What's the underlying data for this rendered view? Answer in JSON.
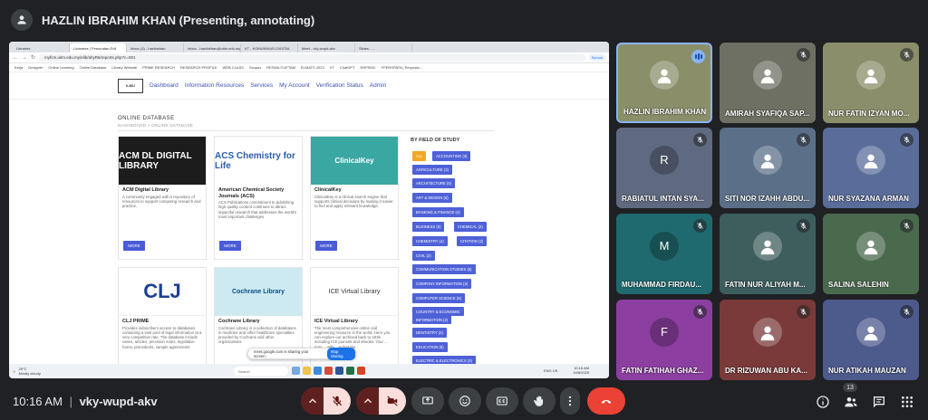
{
  "presenter_banner": "HAZLIN IBRAHIM KHAN (Presenting, annotating)",
  "browser": {
    "tabs": [
      "Libraries",
      "Ucimates | Persuratan-Full",
      "Inbox (3) - hazlinkhan",
      "Inbox - hazlinkhan@uitm.edu.my",
      "KT - KOMUNIKASI DIGITAL",
      "Meet - vky-wupd-akv",
      "Slides - ..."
    ],
    "url": "myfcm.uitm.edu.my/elib/ahyR6/reports.php?c=001",
    "profile": "School",
    "bookmarks": [
      "Kerja",
      "Designer",
      "Online Learning",
      "Online Database",
      "Library Website",
      "PRIME RESEARCH",
      "RESEARCH PROFILE",
      "WEB CLASS",
      "Scopus",
      "RESMA CUPTAM",
      "ELMATS 2023",
      "VT",
      "ChatGPT",
      "ERPSMC",
      "FPERSPATA | Perpusta..."
    ]
  },
  "site": {
    "logo": "ILMU",
    "nav": [
      "Dashboard",
      "Information Resources",
      "Services",
      "My Account",
      "Verification Status",
      "Admin"
    ],
    "section_title": "ONLINE DATABASE",
    "breadcrumb": "DASHBOARD > ONLINE DATABASE",
    "more_label": "MORE",
    "cards": [
      {
        "title": "ACM Digital Library",
        "desc": "A community engaged with a repository of resources to support computing research and practice.",
        "image": "ACM DL DIGITAL LIBRARY"
      },
      {
        "title": "American Chemical Society Journals (ACS)",
        "desc": "ACS Publications commitment to publishing high quality content continues to attract impactful research that addresses the world's most important challenges",
        "image": "ACS Chemistry for Life"
      },
      {
        "title": "ClinicalKey",
        "desc": "ClinicalKey is a clinical search engine that supports clinical decisions by making it easier to find and apply relevant knowledge.",
        "image": "ClinicalKey"
      },
      {
        "title": "CLJ PRIME",
        "desc": "Provides subscribers access to databases containing a vast pool of legal information at a very competitive rate. The database include cases, articles, precision notes, legislative forms, precedents, sample agreements",
        "image": "CLJ"
      },
      {
        "title": "Cochrane Library",
        "desc": "Cochrane Library is a collection of databases in medicine and other healthcare specialties provided by Cochrane and other organizations",
        "image": "Cochrane Library"
      },
      {
        "title": "ICE Virtual Library",
        "desc": "The most comprehensive online civil engineering resource in the world. Here you can explore our archived back to 1836 including ICE journals and ebooks. Your ... may ... with .. to find the",
        "image": "ICE Virtual Library"
      }
    ],
    "field_title": "BY FIELD OF STUDY",
    "chips": [
      "ALL",
      "ACCOUNTING (3)",
      "AGRICULTURE (3)",
      "ARCHITECTURE (5)",
      "ART & DESIGN (6)",
      "BANKING & FINANCE (4)",
      "BUSINESS (5)",
      "CHEMICAL (2)",
      "CHEMISTRY (4)",
      "CITATION (2)",
      "CIVIL (2)",
      "COMMUNICATION STUDIES (5)",
      "COMPANY INFORMATION (3)",
      "COMPUTER SCIENCE (6)",
      "COUNTRY & ECONOMIC",
      "INFORMATION (2)",
      "DENTISTRY (2)",
      "EDUCATION (8)",
      "ELECTRIC & ELECTRONICS (3)"
    ],
    "share_popup": "meet.google.com is sharing your screen.",
    "stop_sharing": "Stop sharing",
    "taskbar_search": "Search",
    "weather": "29°C",
    "weather_sub": "Mostly cloudy",
    "tray": "ENG US",
    "tray_time": "10:16 AM",
    "tray_date": "19/8/2025"
  },
  "participants": [
    {
      "name": "HAZLIN IBRAHIM KHAN",
      "initial": "",
      "color": "#8a8f6a",
      "speaking": true
    },
    {
      "name": "AMIRAH SYAFIQA SAP...",
      "initial": "",
      "color": "#6e7064",
      "speaking": false
    },
    {
      "name": "NUR FATIN IZYAN MO...",
      "initial": "",
      "color": "#8b8e6a",
      "speaking": false
    },
    {
      "name": "RABIATUL INTAN SYA...",
      "initial": "R",
      "color": "#5f6a80",
      "speaking": false
    },
    {
      "name": "SITI NOR IZAHH ABDU...",
      "initial": "",
      "color": "#5b7088",
      "speaking": false
    },
    {
      "name": "NUR SYAZANA ARMAN",
      "initial": "",
      "color": "#5a6d9a",
      "speaking": false
    },
    {
      "name": "MUHAMMAD FIRDAU...",
      "initial": "M",
      "color": "#1f6a6e",
      "speaking": false
    },
    {
      "name": "FATIN NUR ALIYAH M...",
      "initial": "",
      "color": "#3e5e5e",
      "speaking": false
    },
    {
      "name": "SALINA SALEHIN",
      "initial": "",
      "color": "#4a6a4e",
      "speaking": false
    },
    {
      "name": "FATIN FATIHAH GHAZ...",
      "initial": "F",
      "color": "#8c3fa0",
      "speaking": false
    },
    {
      "name": "DR RIZUWAN ABU KA...",
      "initial": "",
      "color": "#7a3a3a",
      "speaking": false
    },
    {
      "name": "NUR ATIKAH MAUZAN",
      "initial": "",
      "color": "#4d5a8c",
      "speaking": false
    }
  ],
  "footer": {
    "time": "10:16 AM",
    "separator": "|",
    "meeting_code": "vky-wupd-akv",
    "participant_count": "13"
  }
}
